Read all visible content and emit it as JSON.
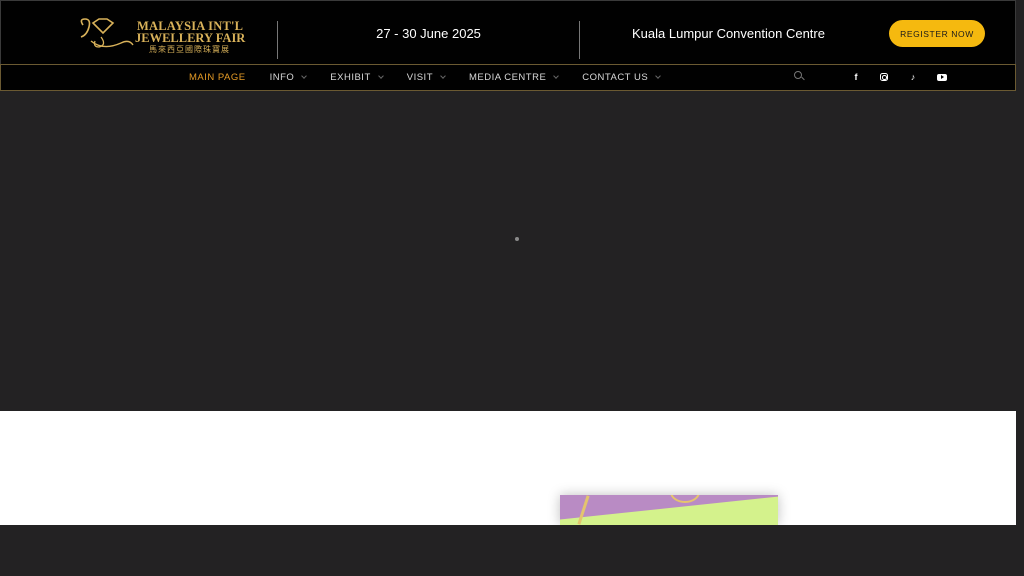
{
  "header": {
    "logo": {
      "line1": "MALAYSIA INT'L",
      "line2": "JEWELLERY FAIR",
      "line3": "馬來西亞國際珠寶展"
    },
    "date": "27 - 30 June 2025",
    "venue": "Kuala Lumpur Convention Centre",
    "register_label": "REGISTER NOW"
  },
  "nav": {
    "items": [
      {
        "label": "MAIN PAGE",
        "active": true
      },
      {
        "label": "INFO"
      },
      {
        "label": "EXHIBIT"
      },
      {
        "label": "VISIT"
      },
      {
        "label": "MEDIA CENTRE"
      },
      {
        "label": "CONTACT US"
      }
    ],
    "social": [
      {
        "icon": "facebook-icon",
        "glyph": "f"
      },
      {
        "icon": "instagram-icon"
      },
      {
        "icon": "tiktok-icon",
        "glyph": "♪"
      },
      {
        "icon": "youtube-icon"
      }
    ]
  },
  "colors": {
    "accent_gold": "#f5b90f",
    "nav_active": "#e59b26",
    "logo_gold": "#d9b25a"
  }
}
